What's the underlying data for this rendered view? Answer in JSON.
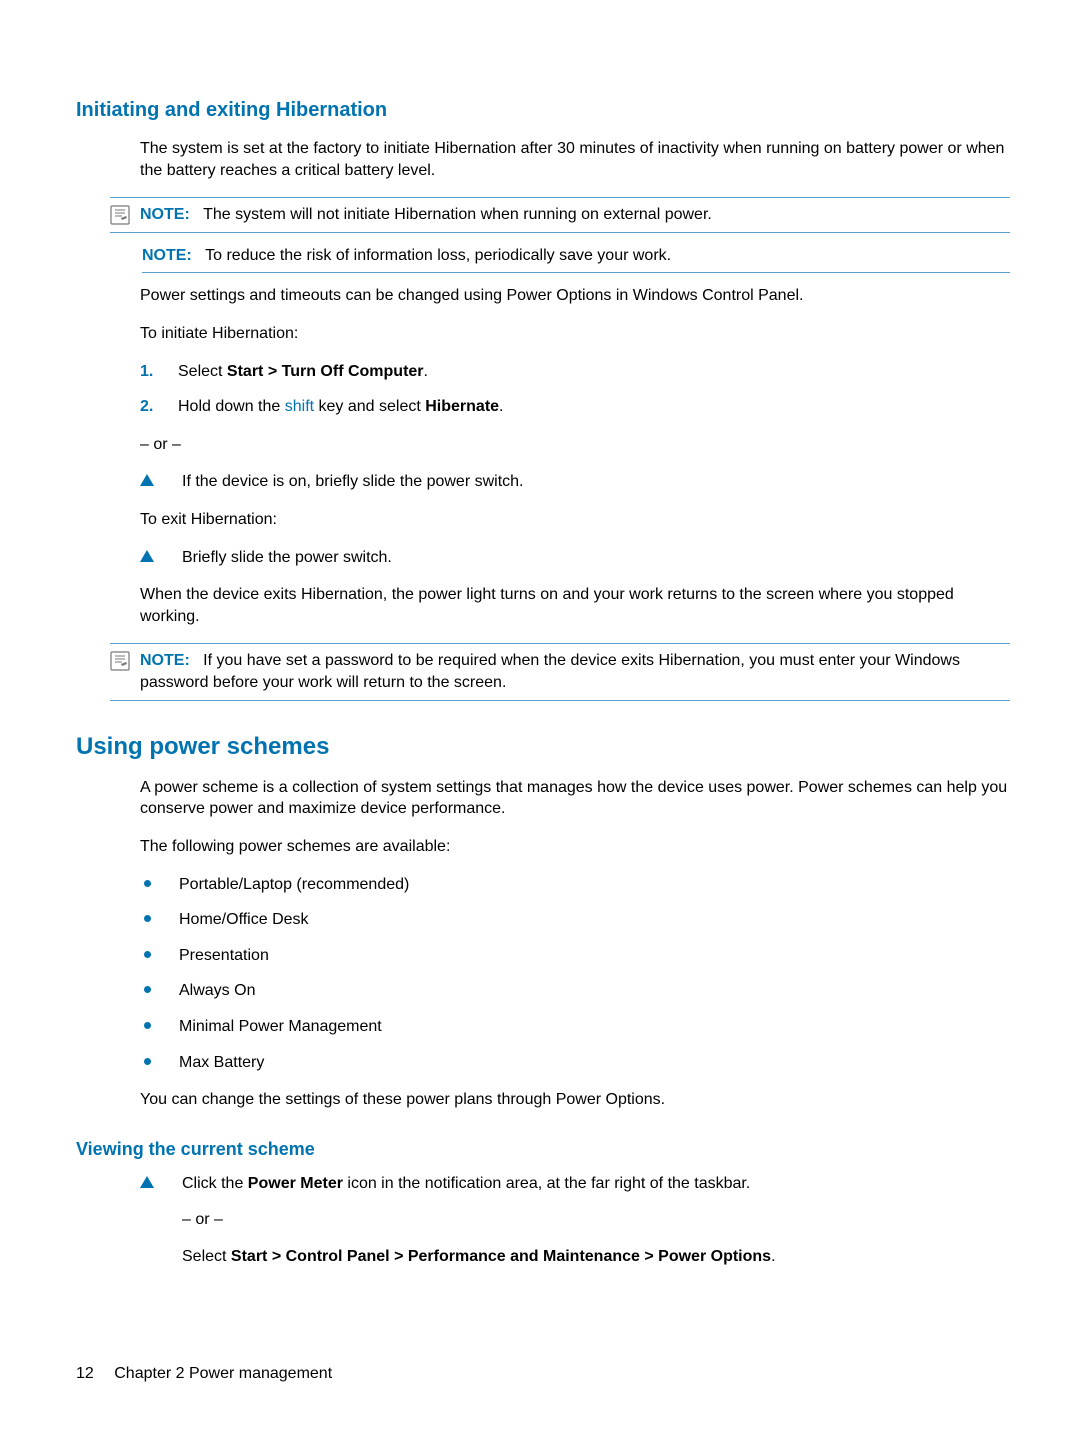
{
  "section1": {
    "heading": "Initiating and exiting Hibernation",
    "intro": "The system is set at the factory to initiate Hibernation after 30 minutes of inactivity when running on battery power or when the battery reaches a critical battery level.",
    "note1_label": "NOTE:",
    "note1_text": "The system will not initiate Hibernation when running on external power.",
    "note2_label": "NOTE:",
    "note2_text": "To reduce the risk of information loss, periodically save your work.",
    "para_settings": "Power settings and timeouts can be changed using Power Options in Windows Control Panel.",
    "para_initiate": "To initiate Hibernation:",
    "step1_pre": "Select ",
    "step1_bold": "Start > Turn Off Computer",
    "step1_post": ".",
    "step2_pre": "Hold down the ",
    "step2_key": "shift",
    "step2_mid": " key and select ",
    "step2_bold": "Hibernate",
    "step2_post": ".",
    "or": "– or –",
    "tri1": "If the device is on, briefly slide the power switch.",
    "para_exit": "To exit Hibernation:",
    "tri2": "Briefly slide the power switch.",
    "para_when": "When the device exits Hibernation, the power light turns on and your work returns to the screen where you stopped working.",
    "note3_label": "NOTE:",
    "note3_text": "If you have set a password to be required when the device exits Hibernation, you must enter your Windows password before your work will return to the screen."
  },
  "section2": {
    "heading": "Using power schemes",
    "intro": "A power scheme is a collection of system settings that manages how the device uses power. Power schemes can help you conserve power and maximize device performance.",
    "para_available": "The following power schemes are available:",
    "items": {
      "i0": "Portable/Laptop (recommended)",
      "i1": "Home/Office Desk",
      "i2": "Presentation",
      "i3": "Always On",
      "i4": "Minimal Power Management",
      "i5": "Max Battery"
    },
    "para_change": "You can change the settings of these power plans through Power Options."
  },
  "section3": {
    "heading": "Viewing the current scheme",
    "step_pre": "Click the ",
    "step_bold": "Power Meter",
    "step_post": " icon in the notification area, at the far right of the taskbar.",
    "or": "– or –",
    "sel_pre": "Select ",
    "sel_bold": "Start > Control Panel > Performance and Maintenance > Power Options",
    "sel_post": "."
  },
  "footer": {
    "page": "12",
    "chapter": "Chapter 2   Power management"
  }
}
